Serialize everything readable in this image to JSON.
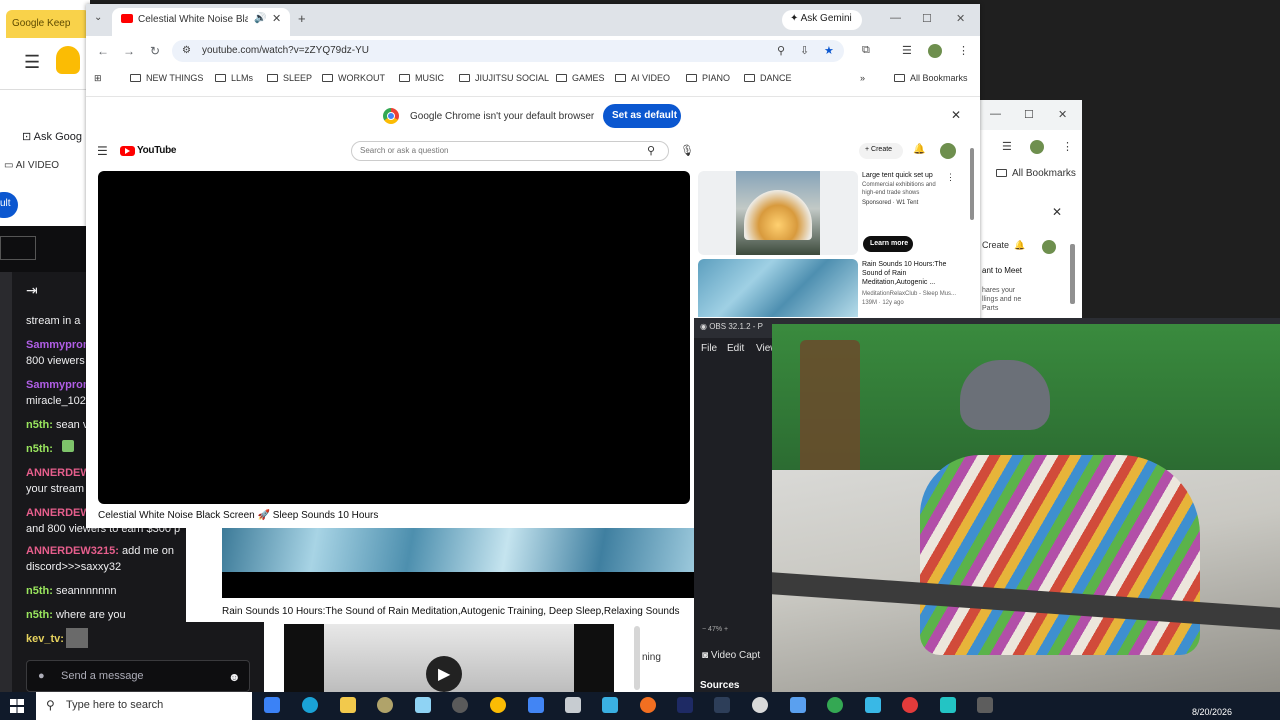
{
  "keep": {
    "tab_title": "Google Keep",
    "ask_google": "Ask Goog",
    "ai_video": "AI VIDEO",
    "default_pill": "ult"
  },
  "chat": {
    "messages": [
      {
        "user": "",
        "text": "stream in a",
        "color": "#efeff1"
      },
      {
        "user": "Sammyprom",
        "text": "",
        "color": "#b05ee6"
      },
      {
        "user": "",
        "text": "800 viewers",
        "color": "#efeff1"
      },
      {
        "user": "Sammyprom",
        "text": "",
        "color": "#b05ee6"
      },
      {
        "user": "",
        "text": "miracle_102",
        "color": "#efeff1"
      },
      {
        "user": "n5th:",
        "text": " sean v",
        "color": "#9ae65e"
      },
      {
        "user": "n5th:",
        "text": "",
        "color": "#9ae65e"
      },
      {
        "user": "ANNERDEW",
        "text": "",
        "color": "#e65e8c"
      },
      {
        "user": "",
        "text": "your stream",
        "color": "#efeff1"
      },
      {
        "user": "ANNERDEW",
        "text": "",
        "color": "#e65e8c"
      },
      {
        "user": "",
        "text": "and 800 viewers to earn $300 p",
        "color": "#efeff1"
      },
      {
        "user": "ANNERDEW3215:",
        "text": " add me on",
        "color": "#e65e8c"
      },
      {
        "user": "",
        "text": "discord>>>saxxy32",
        "color": "#efeff1"
      },
      {
        "user": "n5th:",
        "text": " seannnnnnn",
        "color": "#9ae65e"
      },
      {
        "user": "n5th:",
        "text": " where are you",
        "color": "#9ae65e"
      },
      {
        "user": "kev_tv:",
        "text": "",
        "color": "#e6d25e"
      }
    ],
    "input_placeholder": "Send a message"
  },
  "win2": {
    "bookmarks": "All Bookmarks",
    "create": "Create",
    "meet": "ant to Meet",
    "desc": "hares your llings and ne Parts"
  },
  "chrome": {
    "tab_title": "Celestial White Noise Black",
    "gemini": "Ask Gemini",
    "url": "youtube.com/watch?v=zZYQ79dz-YU",
    "bookmarks": [
      "NEW THINGS",
      "LLMs",
      "SLEEP",
      "WORKOUT",
      "MUSIC",
      "JIUJITSU SOCIAL",
      "GAMES",
      "AI VIDEO",
      "PIANO",
      "DANCE"
    ],
    "all_bookmarks": "All Bookmarks",
    "infobar_text": "Google Chrome isn't your default browser",
    "set_default": "Set as default"
  },
  "youtube": {
    "logo_text": "YouTube",
    "search_placeholder": "Search or ask a question",
    "create": "Create",
    "video_title": "Celestial White Noise Black Screen 🚀 Sleep Sounds 10 Hours",
    "ad": {
      "title": "Large tent quick set up",
      "desc": "Commercial exhibitions and high-end trade shows",
      "sponsor": "Sponsored · W1 Tent",
      "cta": "Learn more"
    },
    "rec": {
      "title": "Rain Sounds 10 Hours:The Sound of Rain Meditation,Autogenic ...",
      "channel": "MeditationRelaxClub - Sleep Mus...",
      "views": "139M · 12y ago"
    }
  },
  "rain_window": {
    "title": "Rain Sounds 10 Hours:The Sound of Rain Meditation,Autogenic Training, Deep Sleep,Relaxing Sounds",
    "side_text": "ning"
  },
  "obs": {
    "title": "OBS 32.1.2 - P",
    "menu": [
      "File",
      "Edit",
      "View"
    ],
    "zoom": "47%",
    "source": "Video Capt",
    "sources_label": "Sources"
  },
  "taskbar": {
    "search_placeholder": "Type here to search",
    "date": "8/20/2026"
  }
}
